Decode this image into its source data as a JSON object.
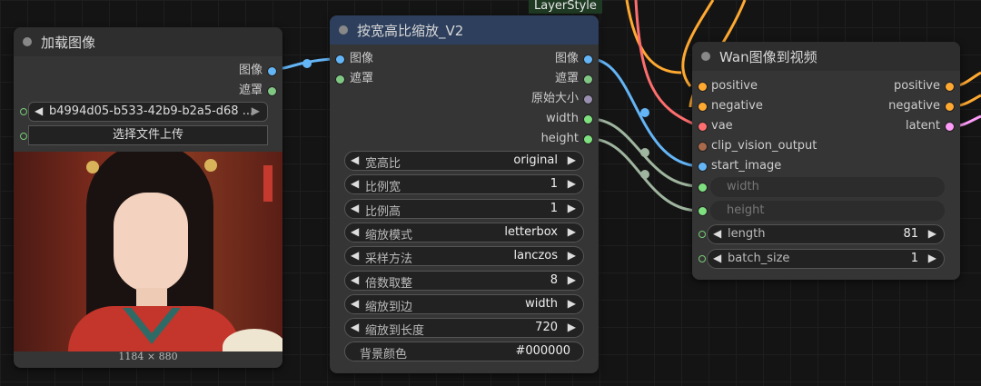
{
  "load_node": {
    "title": "加载图像",
    "out_image": "图像",
    "out_mask": "遮罩",
    "file_value": "b4994d05-b533-42b9-b2a5-d68 ...",
    "upload_label": "选择文件上传",
    "image_size": "1184 × 880"
  },
  "scale_node": {
    "badge": "LayerStyle",
    "title": "按宽高比缩放_V2",
    "in_image": "图像",
    "in_mask": "遮罩",
    "out_image": "图像",
    "out_mask": "遮罩",
    "out_original": "原始大小",
    "out_width": "width",
    "out_height": "height",
    "widgets": [
      {
        "label": "宽高比",
        "value": "original"
      },
      {
        "label": "比例宽",
        "value": "1"
      },
      {
        "label": "比例高",
        "value": "1"
      },
      {
        "label": "缩放模式",
        "value": "letterbox"
      },
      {
        "label": "采样方法",
        "value": "lanczos"
      },
      {
        "label": "倍数取整",
        "value": "8"
      },
      {
        "label": "缩放到边",
        "value": "width"
      },
      {
        "label": "缩放到长度",
        "value": "720"
      }
    ],
    "bg_label": "背景颜色",
    "bg_value": "#000000"
  },
  "wan_node": {
    "title": "Wan图像到视频",
    "inputs": [
      "positive",
      "negative",
      "vae",
      "clip_vision_output",
      "start_image"
    ],
    "outputs": [
      "positive",
      "negative",
      "latent"
    ],
    "converted": [
      "width",
      "height"
    ],
    "widgets": [
      {
        "label": "length",
        "value": "81"
      },
      {
        "label": "batch_size",
        "value": "1"
      }
    ]
  },
  "colors": {
    "image": "#64b5f6",
    "mask": "#81c784",
    "int": "#8ebf8e",
    "positive": "#ffa931",
    "vae": "#ff6e6e",
    "clip": "#a86a4a",
    "latent": "#ff9cf9"
  }
}
